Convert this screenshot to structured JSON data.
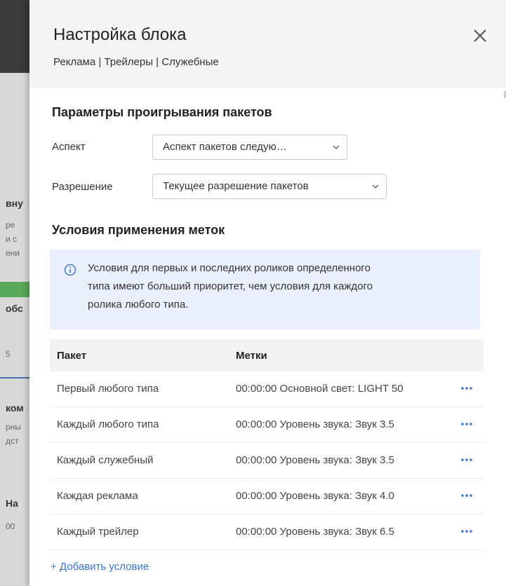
{
  "background": {
    "fragments": [
      "вну",
      "ре",
      "и с",
      "ени",
      "обс",
      "5",
      "ком",
      "рны",
      "дст",
      "На",
      "00"
    ]
  },
  "panel": {
    "title": "Настройка блока",
    "subtitle": "Реклама | Трейлеры | Служебные",
    "close_icon": "close-icon"
  },
  "playback": {
    "title": "Параметры проигрывания пакетов",
    "aspect_label": "Аспект",
    "aspect_value": "Аспект пакетов следую…",
    "resolution_label": "Разрешение",
    "resolution_value": "Текущее разрешение пакетов"
  },
  "conditions": {
    "title": "Условия применения меток",
    "info_icon": "info-icon",
    "info_line1": "Условия для первых и последних роликов определенного",
    "info_line2": "типа имеют больший приоритет, чем условия для каждого",
    "info_line3": "ролика любого типа.",
    "table": {
      "headers": [
        "Пакет",
        "Метки"
      ],
      "rows": [
        {
          "package": "Первый любого типа",
          "marks": "00:00:00 Основной свет: LIGHT 50"
        },
        {
          "package": "Каждый любого типа",
          "marks": "00:00:00 Уровень звука: Звук 3.5"
        },
        {
          "package": "Каждый служебный",
          "marks": "00:00:00 Уровень звука: Звук 3.5"
        },
        {
          "package": "Каждая реклама",
          "marks": "00:00:00 Уровень звука: Звук 4.0"
        },
        {
          "package": "Каждый трейлер",
          "marks": "00:00:00 Уровень звука: Звук 6.5"
        }
      ]
    },
    "add_condition": "+ Добавить условие"
  },
  "colors": {
    "accent": "#3b73c8",
    "info_bg": "#e9f0fb",
    "header_bg": "#f4f4f4"
  }
}
